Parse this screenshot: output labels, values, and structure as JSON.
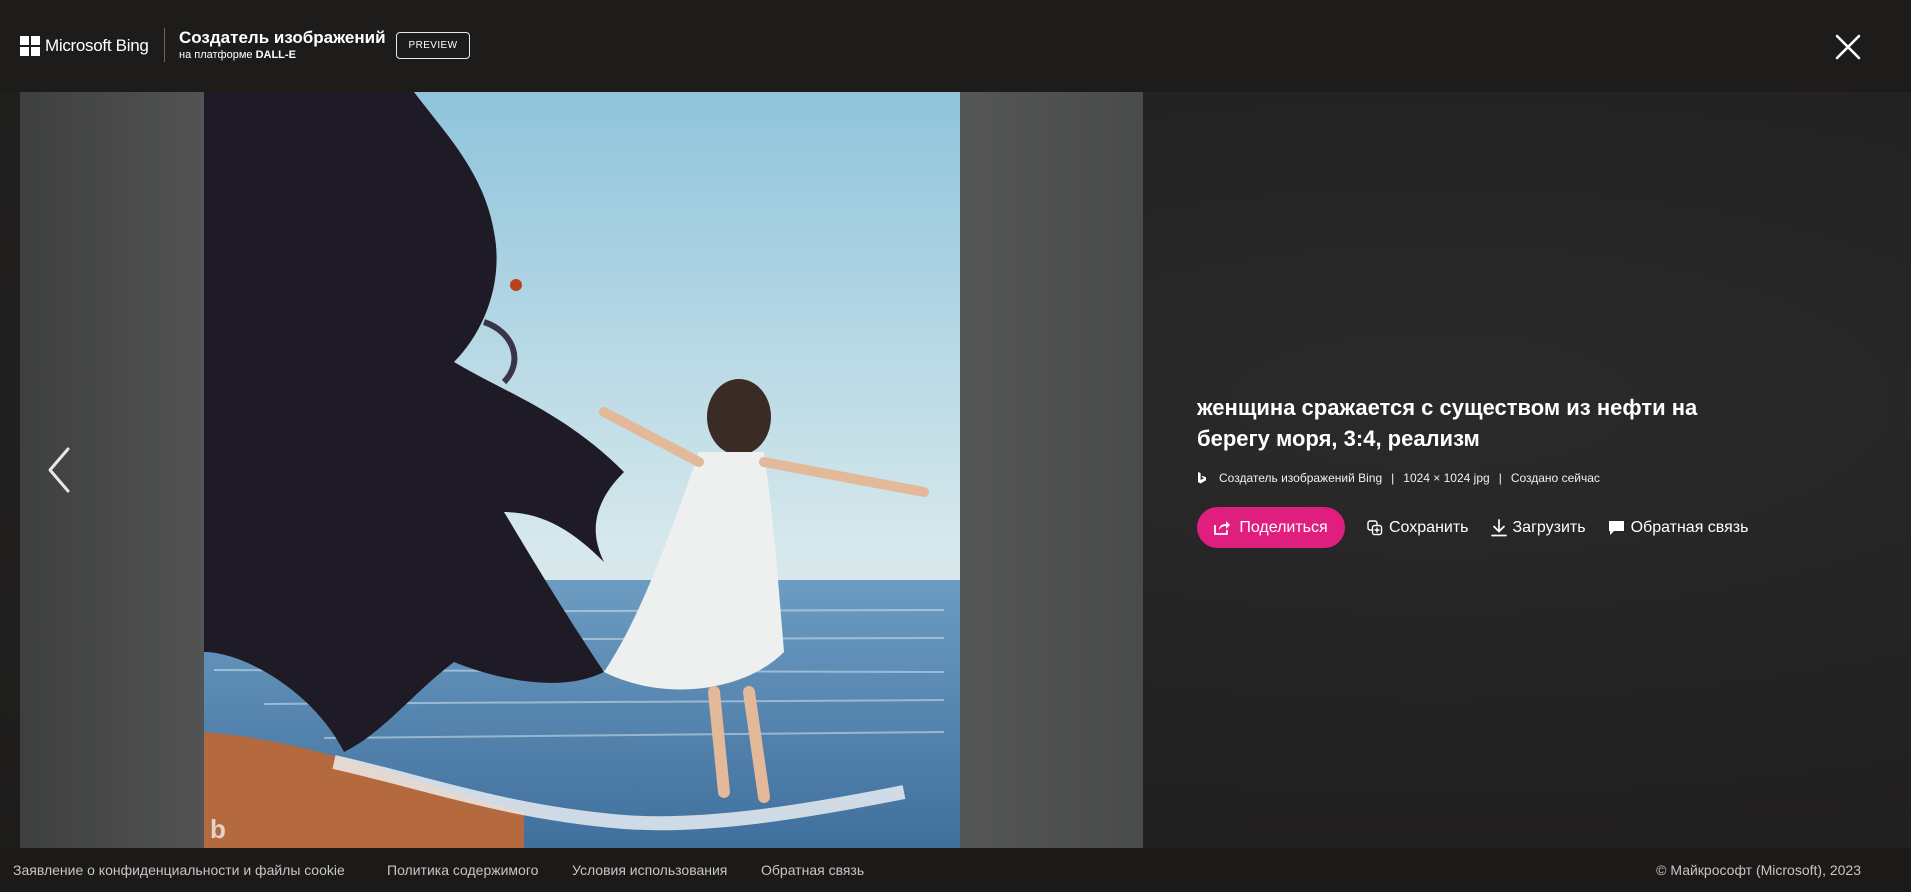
{
  "header": {
    "brand": "Microsoft Bing",
    "title": "Создатель изображений",
    "subtitle_prefix": "на платформе",
    "subtitle_engine": "DALL-E",
    "badge": "PREVIEW"
  },
  "image": {
    "alt": "женщина сражается с существом из нефти на берегу моря, 3:4, реализм"
  },
  "details": {
    "caption": "женщина сражается с существом из нефти на берегу моря, 3:4, реализм",
    "source": "Создатель изображений Bing",
    "dimensions": "1024 × 1024 jpg",
    "created": "Создано сейчас",
    "separator": "|"
  },
  "actions": {
    "share": "Поделиться",
    "save": "Сохранить",
    "download": "Загрузить",
    "feedback": "Обратная связь"
  },
  "footer": {
    "links": [
      "Заявление о конфиденциальности и файлы cookie",
      "Политика содержимого",
      "Условия использования",
      "Обратная связь"
    ],
    "copyright": "© Майкрософт (Microsoft), 2023"
  },
  "colors": {
    "accent": "#e01e7d",
    "header_bg": "#1d1c1b",
    "footer_bg": "#1b1a19"
  },
  "icons": [
    "microsoft-logo-icon",
    "close-icon",
    "chevron-left-icon",
    "bing-icon",
    "share-icon",
    "save-icon",
    "download-icon",
    "feedback-icon"
  ]
}
